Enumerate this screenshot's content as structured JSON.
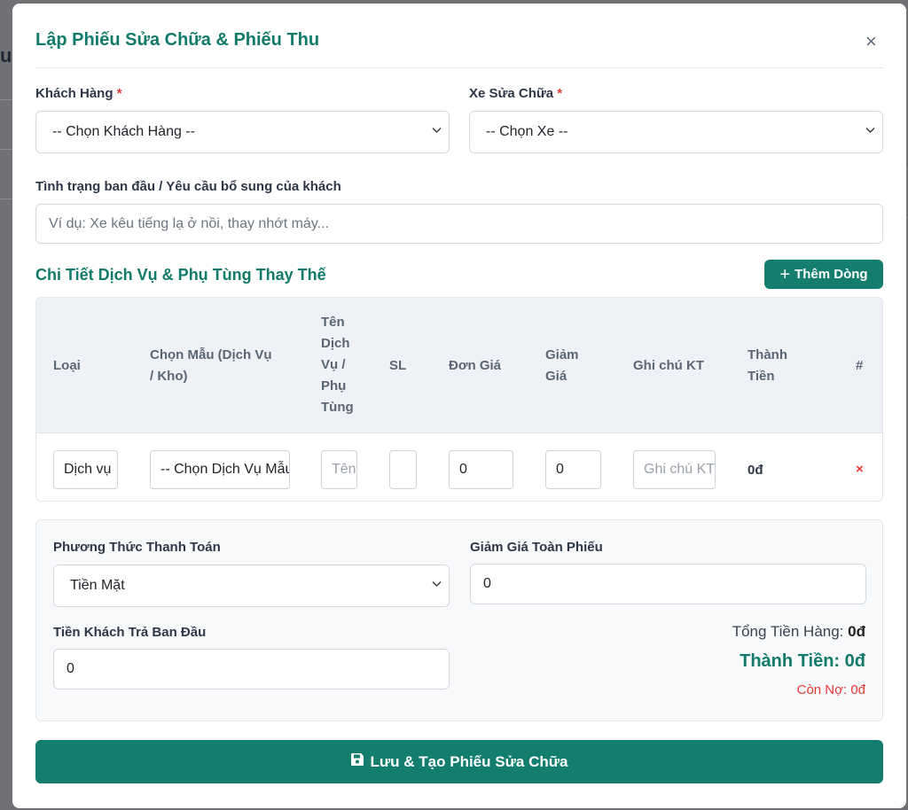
{
  "background": {
    "fragment": "u"
  },
  "modal": {
    "title": "Lập Phiếu Sửa Chữa & Phiếu Thu",
    "close": "×"
  },
  "customer": {
    "label": "Khách Hàng",
    "required": "*",
    "value": "-- Chọn Khách Hàng --"
  },
  "vehicle": {
    "label": "Xe Sửa Chữa",
    "required": "*",
    "value": "-- Chọn Xe --"
  },
  "condition": {
    "label": "Tình trạng ban đầu / Yêu cầu bổ sung của khách",
    "placeholder": "Ví dụ: Xe kêu tiếng lạ ở nồi, thay nhớt máy..."
  },
  "details": {
    "title": "Chi Tiết Dịch Vụ & Phụ Tùng Thay Thế",
    "add_button": "Thêm Dòng",
    "columns": {
      "type": "Loại",
      "template": [
        "Chọn Mẫu (Dịch Vụ",
        "/ Kho)"
      ],
      "name": [
        "Tên",
        "Dịch",
        "Vụ /",
        "Phụ",
        "Tùng"
      ],
      "qty": "SL",
      "price": "Đơn Giá",
      "discount": [
        "Giảm",
        "Giá"
      ],
      "note": "Ghi chú KT",
      "total": [
        "Thành",
        "Tiền"
      ],
      "action": "#"
    },
    "row": {
      "type": "Dịch vụ",
      "template": "-- Chọn Dịch Vụ Mẫu --",
      "name_placeholder": "Tên",
      "qty": "",
      "price": "0",
      "discount": "0",
      "note_placeholder": "Ghi chú KT",
      "total": "0đ",
      "delete": "×"
    }
  },
  "payment": {
    "method_label": "Phương Thức Thanh Toán",
    "method_value": "Tiền Mặt",
    "discount_label": "Giảm Giá Toàn Phiếu",
    "discount_value": "0",
    "paid_label": "Tiền Khách Trả Ban Đầu",
    "paid_value": "0",
    "subtotal_label": "Tổng Tiền Hàng:",
    "subtotal_value": "0đ",
    "total_label": "Thành Tiền:",
    "total_value": "0đ",
    "debt_label": "Còn Nợ:",
    "debt_value": "0đ"
  },
  "save_button": "Lưu & Tạo Phiếu Sửa Chữa",
  "colors": {
    "accent": "#137e6e",
    "title": "#127a6a",
    "danger": "#e53935"
  },
  "icons": [
    "close-icon",
    "chevron-down-icon",
    "plus-icon",
    "delete-icon",
    "save-icon"
  ]
}
